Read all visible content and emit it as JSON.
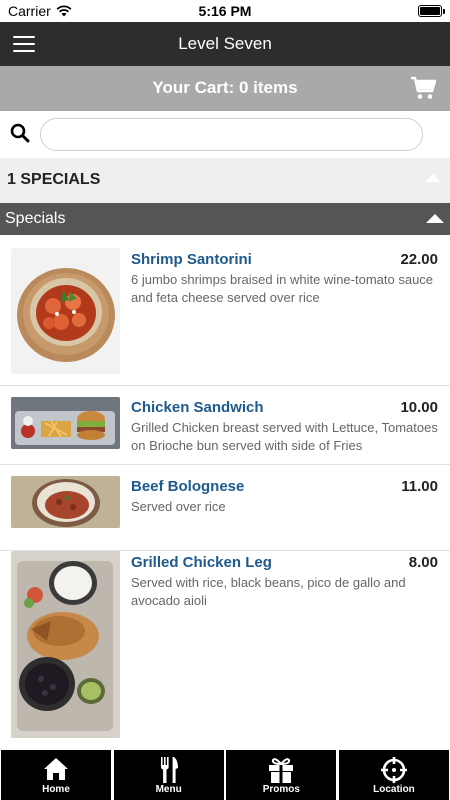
{
  "status_bar": {
    "carrier": "Carrier",
    "time": "5:16 PM"
  },
  "nav": {
    "title": "Level Seven"
  },
  "cart": {
    "label": "Your Cart: 0 items"
  },
  "search": {
    "value": "",
    "placeholder": ""
  },
  "section": {
    "title": "1 SPECIALS"
  },
  "category": {
    "title": "Specials"
  },
  "items": [
    {
      "name": "Shrimp Santorini",
      "price": "22.00",
      "description": "6 jumbo shrimps braised in white wine-tomato sauce and feta cheese served over rice"
    },
    {
      "name": "Chicken Sandwich",
      "price": "10.00",
      "description": "Grilled Chicken breast served with Lettuce, Tomatoes on Brioche bun served with side of Fries"
    },
    {
      "name": "Beef Bolognese",
      "price": "11.00",
      "description": "Served over rice"
    },
    {
      "name": "Grilled Chicken Leg",
      "price": "8.00",
      "description": "Served with rice, black beans, pico de gallo and avocado aioli"
    }
  ],
  "tabs": [
    {
      "label": "Home",
      "icon": "home-icon"
    },
    {
      "label": "Menu",
      "icon": "fork-knife-icon"
    },
    {
      "label": "Promos",
      "icon": "gift-icon"
    },
    {
      "label": "Location",
      "icon": "crosshair-icon"
    }
  ]
}
